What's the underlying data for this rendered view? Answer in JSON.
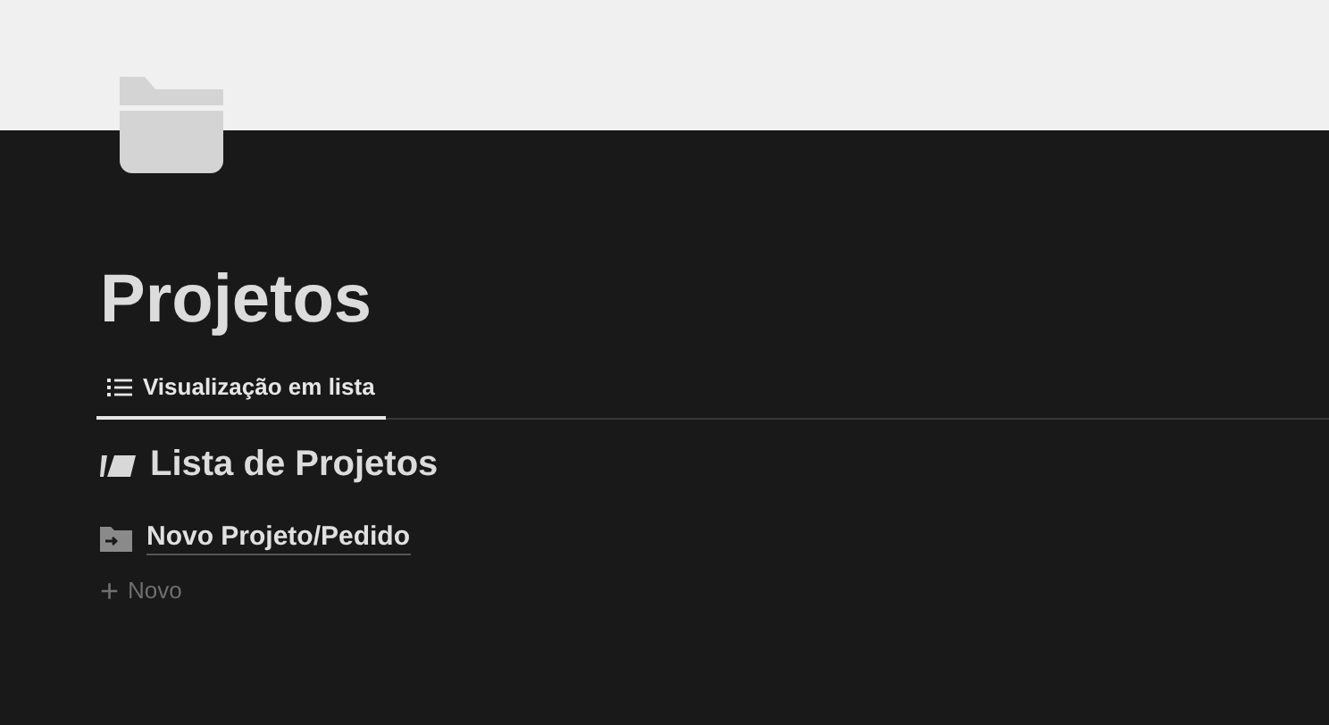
{
  "page": {
    "title": "Projetos"
  },
  "tabs": [
    {
      "label": "Visualização em lista",
      "selected": true
    }
  ],
  "list": {
    "title": "Lista de Projetos",
    "items": [
      {
        "label": "Novo Projeto/Pedido"
      }
    ],
    "new_button": {
      "icon": "+",
      "label": "Novo"
    }
  }
}
